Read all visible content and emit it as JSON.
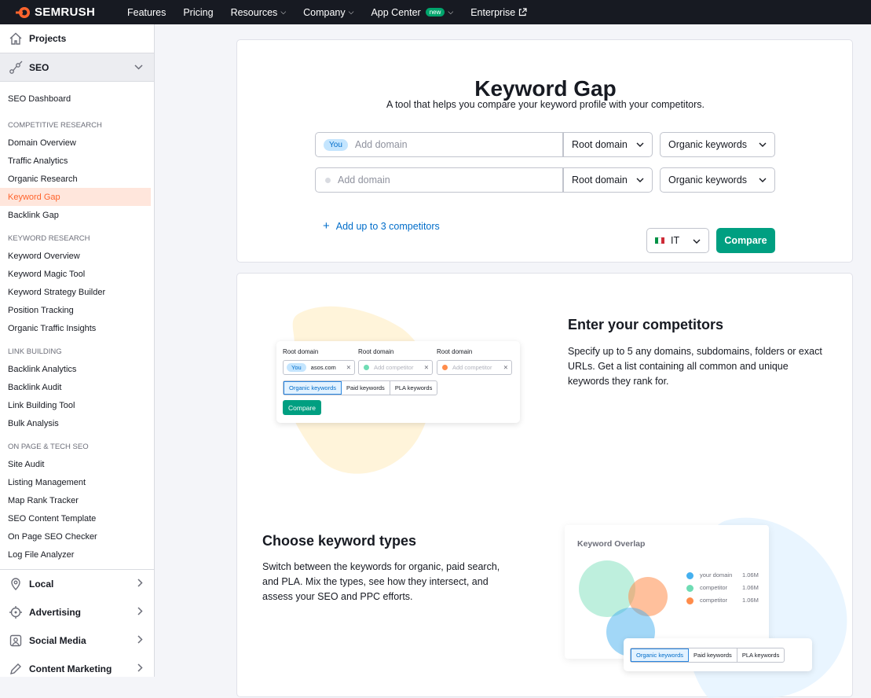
{
  "topnav": {
    "brand": "SEMRUSH",
    "items": [
      "Features",
      "Pricing",
      "Resources",
      "Company",
      "App Center",
      "Enterprise"
    ],
    "new_badge": "new"
  },
  "sidebar": {
    "projects": "Projects",
    "seo": "SEO",
    "dashboard": "SEO Dashboard",
    "groups": [
      {
        "head": "COMPETITIVE RESEARCH",
        "items": [
          "Domain Overview",
          "Traffic Analytics",
          "Organic Research",
          "Keyword Gap",
          "Backlink Gap"
        ]
      },
      {
        "head": "KEYWORD RESEARCH",
        "items": [
          "Keyword Overview",
          "Keyword Magic Tool",
          "Keyword Strategy Builder",
          "Position Tracking",
          "Organic Traffic Insights"
        ]
      },
      {
        "head": "LINK BUILDING",
        "items": [
          "Backlink Analytics",
          "Backlink Audit",
          "Link Building Tool",
          "Bulk Analysis"
        ]
      },
      {
        "head": "ON PAGE & TECH SEO",
        "items": [
          "Site Audit",
          "Listing Management",
          "Map Rank Tracker",
          "SEO Content Template",
          "On Page SEO Checker",
          "Log File Analyzer"
        ]
      }
    ],
    "sections": [
      "Local",
      "Advertising",
      "Social Media",
      "Content Marketing"
    ]
  },
  "tool": {
    "title": "Keyword Gap",
    "subtitle": "A tool that helps you compare your keyword profile with your competitors.",
    "you_badge": "You",
    "domain_placeholder": "Add domain",
    "scope": "Root domain",
    "kw_type": "Organic keywords",
    "add_competitors": "Add up to 3 competitors",
    "database": "IT",
    "compare": "Compare"
  },
  "features": {
    "enter_title": "Enter your competitors",
    "enter_text_1": "Specify up to 5 any domains, subdomains, folders or exact",
    "enter_text_2": "URLs. Get a list containing all common and unique",
    "enter_text_3": "keywords they rank for.",
    "choose_title": "Choose keyword types",
    "choose_text_1": "Switch between the keywords for organic, paid search,",
    "choose_text_2": "and PLA. Mix the types, see how they intersect, and",
    "choose_text_3": "assess your SEO and PPC efforts."
  },
  "illustration": {
    "root_domain": "Root domain",
    "you": "You",
    "domain": "asos.com",
    "add_competitor": "Add competitor",
    "tab_organic": "Organic keywords",
    "tab_paid": "Paid keywords",
    "tab_pla": "PLA keywords",
    "compare": "Compare",
    "overlap_title": "Keyword Overlap",
    "legend": [
      {
        "label": "your domain",
        "value": "1.06M",
        "color": "#45b0ef"
      },
      {
        "label": "competitor",
        "value": "1.06M",
        "color": "#6fdcb4"
      },
      {
        "label": "competitor",
        "value": "1.06M",
        "color": "#ff8c4b"
      }
    ]
  },
  "colors": {
    "accent": "#ff642d",
    "primary_button": "#009f81",
    "link": "#006dca"
  }
}
